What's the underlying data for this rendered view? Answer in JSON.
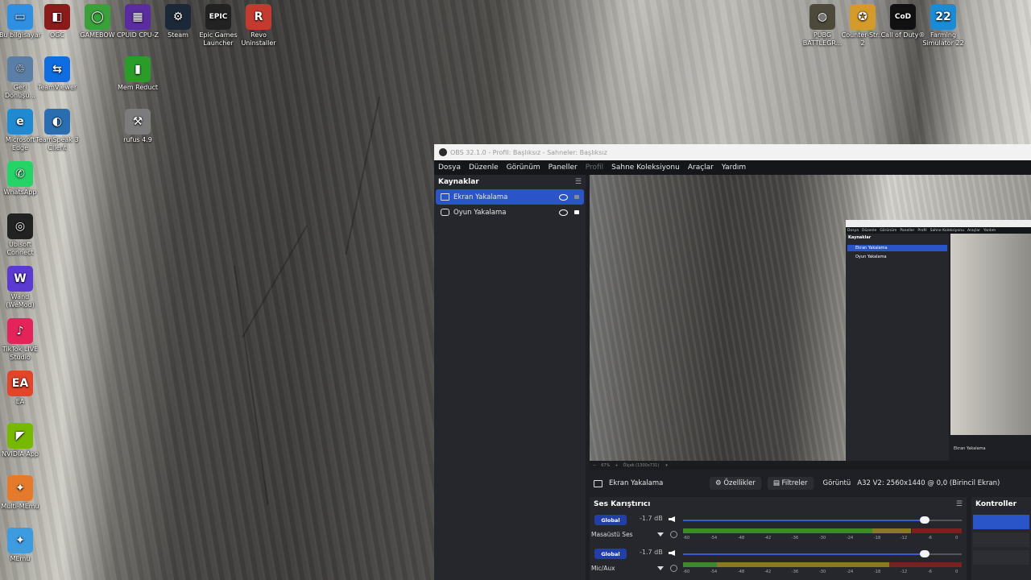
{
  "desktop": {
    "icons": [
      {
        "label": "Bu bilgisayar",
        "color": "#2f8fe3",
        "glyph": "▭"
      },
      {
        "label": "OGC",
        "color": "#8b1a1a",
        "glyph": "◧"
      },
      {
        "label": "GAMEBOW",
        "color": "#39a03a",
        "glyph": "◯"
      },
      {
        "label": "CPUID CPU-Z",
        "color": "#5a2ca0",
        "glyph": "▦"
      },
      {
        "label": "Steam",
        "color": "#1b2838",
        "glyph": "⚙"
      },
      {
        "label": "Epic Games Launcher",
        "color": "#222222",
        "glyph": "EPIC"
      },
      {
        "label": "Revo Uninstaller",
        "color": "#c53a2f",
        "glyph": "R"
      },
      {
        "label": "Geri Dönüşü...",
        "color": "#5a7ea6",
        "glyph": "♲"
      },
      {
        "label": "TeamViewer",
        "color": "#0e6de0",
        "glyph": "⇆"
      },
      {
        "label": "Mem Reduct",
        "color": "#2a9c2a",
        "glyph": "▮"
      },
      {
        "label": "Microsoft Edge",
        "color": "#1f8ad1",
        "glyph": "e"
      },
      {
        "label": "TeamSpeak 3 Client",
        "color": "#2a6db0",
        "glyph": "◐"
      },
      {
        "label": "rufus 4.9",
        "color": "#7c7c7c",
        "glyph": "⚒"
      },
      {
        "label": "WhatsApp",
        "color": "#25d366",
        "glyph": "✆"
      },
      {
        "label": "Ubisoft Connect",
        "color": "#222222",
        "glyph": "◎"
      },
      {
        "label": "Wand (WeMod)",
        "color": "#5b3ad1",
        "glyph": "W"
      },
      {
        "label": "TikTok LIVE Studio",
        "color": "#e3245a",
        "glyph": "♪"
      },
      {
        "label": "EA",
        "color": "#e2452a",
        "glyph": "EA"
      },
      {
        "label": "NVIDIA App",
        "color": "#76b900",
        "glyph": "◤"
      },
      {
        "label": "Multi-MEmu",
        "color": "#e57a2b",
        "glyph": "✦"
      },
      {
        "label": "MEmu",
        "color": "#3d9be0",
        "glyph": "✦"
      },
      {
        "label": "PUBG BATTLEGR...",
        "color": "#4d4a3c",
        "glyph": "◍"
      },
      {
        "label": "Counter-Str... 2",
        "color": "#d49a2a",
        "glyph": "✪"
      },
      {
        "label": "Call of Duty®",
        "color": "#111111",
        "glyph": "CoD"
      },
      {
        "label": "Farming Simulator 22",
        "color": "#1b8bd6",
        "glyph": "22"
      }
    ]
  },
  "obs": {
    "title": "OBS 32.1.0 - Profil: Başlıksız - Sahneler: Başlıksız",
    "menu": [
      "Dosya",
      "Düzenle",
      "Görünüm",
      "Paneller",
      "Profil",
      "Sahne Koleksiyonu",
      "Araçlar",
      "Yardım"
    ],
    "sources": {
      "heading": "Kaynaklar",
      "items": [
        {
          "label": "Ekran Yakalama",
          "selected": true
        },
        {
          "label": "Oyun Yakalama",
          "selected": false
        }
      ]
    },
    "preview": {
      "zoom": "67%",
      "scale": "Ölçek (1300x731)",
      "nested_label": "Ekran Yakalama"
    },
    "context_bar": {
      "source_name": "Ekran Yakalama",
      "properties": "Özellikler",
      "filters": "Filtreler",
      "display_label": "Görüntü",
      "display_value": "A32 V2: 2560x1440 @ 0,0 (Birincil Ekran)"
    },
    "mixer": {
      "heading": "Ses Karıştırıcı",
      "channels": [
        {
          "global": "Global",
          "db": "-1.7 dB",
          "name": "Masaüstü Ses",
          "volume": 0.96,
          "level_green": 0.68,
          "level_yellow": 0.82
        },
        {
          "global": "Global",
          "db": "-1.7 dB",
          "name": "Mic/Aux",
          "volume": 0.96,
          "level_green": 0.12,
          "level_yellow": 0.74
        }
      ],
      "ticks": [
        "-60",
        "-54",
        "-48",
        "-42",
        "-36",
        "-30",
        "-24",
        "-18",
        "-12",
        "-6",
        "0"
      ]
    },
    "controls": {
      "heading": "Kontroller"
    }
  }
}
